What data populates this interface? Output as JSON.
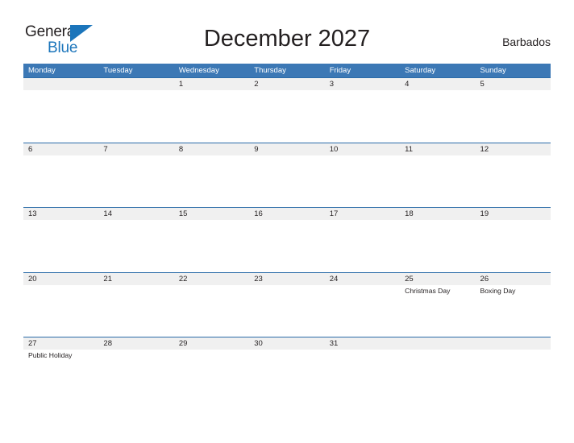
{
  "brand": {
    "line1": "General",
    "line2": "Blue",
    "flag_icon": "blue-triangle-flag-icon",
    "line1_color": "#231f20",
    "line2_color": "#1b75bb"
  },
  "header": {
    "title": "December 2027",
    "country": "Barbados"
  },
  "theme": {
    "header_blue": "#3c78b5",
    "divider_blue": "#2b6ca8",
    "band_gray": "#f0f0f0",
    "text_dark": "#231f20",
    "page_background": "#ffffff"
  },
  "calendar": {
    "weekdays": [
      "Monday",
      "Tuesday",
      "Wednesday",
      "Thursday",
      "Friday",
      "Saturday",
      "Sunday"
    ],
    "weeks": [
      [
        {
          "day": "",
          "event": ""
        },
        {
          "day": "",
          "event": ""
        },
        {
          "day": "1",
          "event": ""
        },
        {
          "day": "2",
          "event": ""
        },
        {
          "day": "3",
          "event": ""
        },
        {
          "day": "4",
          "event": ""
        },
        {
          "day": "5",
          "event": ""
        }
      ],
      [
        {
          "day": "6",
          "event": ""
        },
        {
          "day": "7",
          "event": ""
        },
        {
          "day": "8",
          "event": ""
        },
        {
          "day": "9",
          "event": ""
        },
        {
          "day": "10",
          "event": ""
        },
        {
          "day": "11",
          "event": ""
        },
        {
          "day": "12",
          "event": ""
        }
      ],
      [
        {
          "day": "13",
          "event": ""
        },
        {
          "day": "14",
          "event": ""
        },
        {
          "day": "15",
          "event": ""
        },
        {
          "day": "16",
          "event": ""
        },
        {
          "day": "17",
          "event": ""
        },
        {
          "day": "18",
          "event": ""
        },
        {
          "day": "19",
          "event": ""
        }
      ],
      [
        {
          "day": "20",
          "event": ""
        },
        {
          "day": "21",
          "event": ""
        },
        {
          "day": "22",
          "event": ""
        },
        {
          "day": "23",
          "event": ""
        },
        {
          "day": "24",
          "event": ""
        },
        {
          "day": "25",
          "event": "Christmas Day"
        },
        {
          "day": "26",
          "event": "Boxing Day"
        }
      ],
      [
        {
          "day": "27",
          "event": "Public Holiday"
        },
        {
          "day": "28",
          "event": ""
        },
        {
          "day": "29",
          "event": ""
        },
        {
          "day": "30",
          "event": ""
        },
        {
          "day": "31",
          "event": ""
        },
        {
          "day": "",
          "event": ""
        },
        {
          "day": "",
          "event": ""
        }
      ]
    ]
  }
}
